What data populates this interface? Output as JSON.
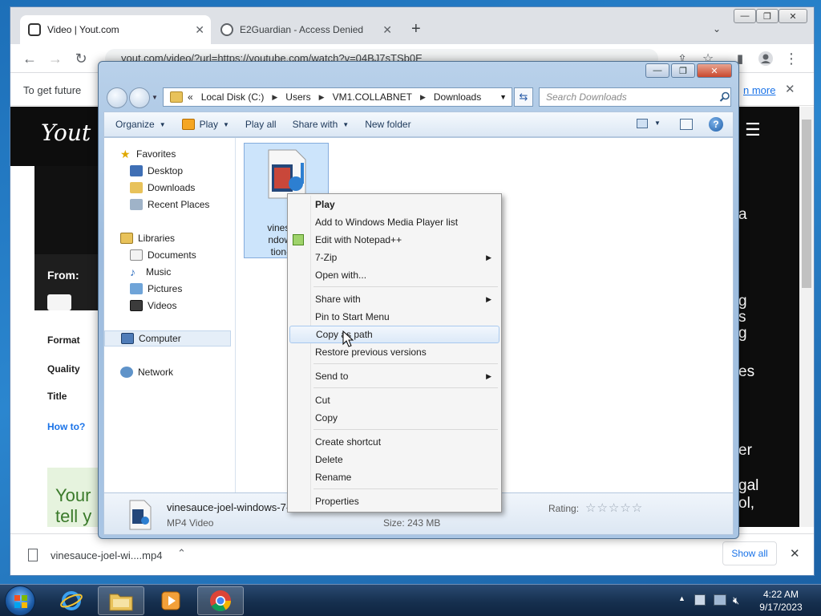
{
  "browser": {
    "tabs": [
      {
        "title": "Video | Yout.com",
        "active": true
      },
      {
        "title": "E2Guardian - Access Denied",
        "active": false
      }
    ],
    "new_tab": "+",
    "url": "yout.com/video/?url=https://youtube.com/watch?v=04BJ7sTSb0E",
    "infobar_text": "To get future",
    "infobar_link": "n more",
    "infobar_close": "✕"
  },
  "website": {
    "logo": "Yout",
    "from_label": "From:",
    "format_label": "Format",
    "quality_label": "Quality",
    "title_label": "Title",
    "howto_link": "How to?",
    "banner_line1": "Your",
    "banner_line2": "tell y",
    "right_fragments": [
      "a",
      "g",
      "s",
      "g",
      "es",
      "er",
      "gal",
      "ol,"
    ]
  },
  "download_bar": {
    "file": "vinesauce-joel-wi....mp4",
    "show_all": "Show all",
    "close": "✕"
  },
  "explorer": {
    "address": [
      "«",
      "Local Disk (C:)",
      "Users",
      "VM1.COLLABNET",
      "Downloads"
    ],
    "search_placeholder": "Search Downloads",
    "toolbar": {
      "organize": "Organize",
      "play": "Play",
      "play_all": "Play all",
      "share_with": "Share with",
      "new_folder": "New folder"
    },
    "nav": {
      "favorites": "Favorites",
      "desktop": "Desktop",
      "downloads": "Downloads",
      "recent": "Recent Places",
      "libraries": "Libraries",
      "documents": "Documents",
      "music": "Music",
      "pictures": "Pictures",
      "videos": "Videos",
      "computer": "Computer",
      "network": "Network"
    },
    "file_label_lines": [
      "vinesauc",
      "ndows-7",
      "tion-full"
    ],
    "details": {
      "name": "vinesauce-joel-windows-7-",
      "type": "MP4 Video",
      "rating_label": "Rating:",
      "rating_stars": "☆☆☆☆☆",
      "size": "Size: 243 MB"
    }
  },
  "context_menu": {
    "items": [
      {
        "label": "Play",
        "bold": true
      },
      {
        "label": "Add to Windows Media Player list"
      },
      {
        "label": "Edit with Notepad++",
        "icon": true
      },
      {
        "label": "7-Zip",
        "submenu": true
      },
      {
        "label": "Open with..."
      },
      {
        "label": "Share with",
        "submenu": true
      },
      {
        "label": "Pin to Start Menu"
      },
      {
        "label": "Copy as path",
        "highlighted": true
      },
      {
        "label": "Restore previous versions"
      },
      {
        "label": "Send to",
        "submenu": true
      },
      {
        "label": "Cut"
      },
      {
        "label": "Copy"
      },
      {
        "label": "Create shortcut"
      },
      {
        "label": "Delete"
      },
      {
        "label": "Rename"
      },
      {
        "label": "Properties"
      }
    ]
  },
  "taskbar": {
    "time": "4:22 AM",
    "date": "9/17/2023"
  }
}
